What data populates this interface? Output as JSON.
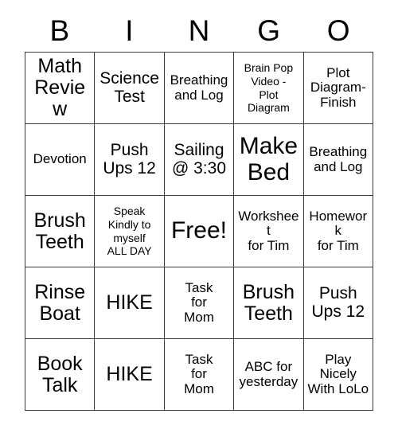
{
  "card": {
    "title": "Bingo Card",
    "header": {
      "letters": [
        "B",
        "I",
        "N",
        "G",
        "O"
      ]
    },
    "free_space": "Free!",
    "colors": {
      "border": "#3a3a3a",
      "cell_background": "#ffffff",
      "text": "#000000",
      "page_background": "#ffffff"
    },
    "rows": [
      [
        {
          "text": "Math\nReview",
          "size": "lg"
        },
        {
          "text": "Science\nTest",
          "size": "md"
        },
        {
          "text": "Breathing\nand Log",
          "size": "sm"
        },
        {
          "text": "Brain Pop\nVideo -\nPlot\nDiagram",
          "size": "xs"
        },
        {
          "text": "Plot\nDiagram-\nFinish",
          "size": "sm"
        }
      ],
      [
        {
          "text": "Devotion",
          "size": "sm"
        },
        {
          "text": "Push\nUps 12",
          "size": "md"
        },
        {
          "text": "Sailing\n@ 3:30",
          "size": "md"
        },
        {
          "text": "Make\nBed",
          "size": "xl"
        },
        {
          "text": "Breathing\nand Log",
          "size": "sm"
        }
      ],
      [
        {
          "text": "Brush\nTeeth",
          "size": "lg"
        },
        {
          "text": "Speak\nKindly to\nmyself\nALL DAY",
          "size": "xs"
        },
        {
          "text": "Free!",
          "size": "xl"
        },
        {
          "text": "Worksheet\nfor Tim",
          "size": "sm"
        },
        {
          "text": "Homework\nfor Tim",
          "size": "sm"
        }
      ],
      [
        {
          "text": "Rinse\nBoat",
          "size": "lg"
        },
        {
          "text": "HIKE",
          "size": "lg"
        },
        {
          "text": "Task\nfor\nMom",
          "size": "sm"
        },
        {
          "text": "Brush\nTeeth",
          "size": "lg"
        },
        {
          "text": "Push\nUps 12",
          "size": "md"
        }
      ],
      [
        {
          "text": "Book\nTalk",
          "size": "lg"
        },
        {
          "text": "HIKE",
          "size": "lg"
        },
        {
          "text": "Task\nfor\nMom",
          "size": "sm"
        },
        {
          "text": "ABC for\nyesterday",
          "size": "sm"
        },
        {
          "text": "Play\nNicely\nWith LoLo",
          "size": "sm"
        }
      ]
    ]
  }
}
